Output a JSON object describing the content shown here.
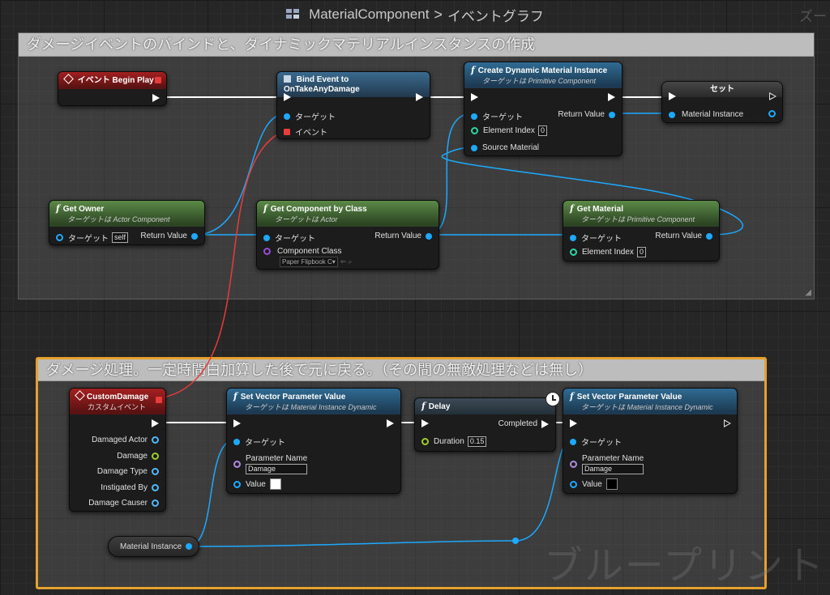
{
  "header": {
    "title": "MaterialComponent",
    "breadcrumb_sep": ">",
    "graph": "イベントグラフ",
    "zoom": "ズー"
  },
  "watermark": "ブループリント",
  "comments": [
    {
      "title": "ダメージイベントのバインドと、ダイナミックマテリアルインスタンスの作成"
    },
    {
      "title": "ダメージ処理。一定時間白加算した後で元に戻る。（その間の無敵処理などは無し）"
    }
  ],
  "nodes": {
    "begin_play": {
      "title": "イベント Begin Play"
    },
    "bind_event": {
      "title": "Bind Event to OnTakeAnyDamage",
      "target": "ターゲット",
      "event": "イベント"
    },
    "create_dmi": {
      "title": "Create Dynamic Material Instance",
      "subtitle": "ターゲットは Primitive Component",
      "target": "ターゲット",
      "return": "Return Value",
      "element_index": "Element Index",
      "element_index_val": "0",
      "source_material": "Source Material"
    },
    "set_node": {
      "title": "セット",
      "material_instance": "Material Instance"
    },
    "get_owner": {
      "title": "Get Owner",
      "subtitle": "ターゲットは Actor Component",
      "target": "ターゲット",
      "target_val": "self",
      "return": "Return Value"
    },
    "get_component": {
      "title": "Get Component by Class",
      "subtitle": "ターゲットは Actor",
      "target": "ターゲット",
      "return": "Return Value",
      "component_class": "Component Class",
      "component_class_val": "Paper Flipbook C▾"
    },
    "get_material": {
      "title": "Get Material",
      "subtitle": "ターゲットは Primitive Component",
      "target": "ターゲット",
      "return": "Return Value",
      "element_index": "Element Index",
      "element_index_val": "0"
    },
    "custom_damage": {
      "title": "CustomDamage",
      "subtitle": "カスタムイベント",
      "pins": [
        "Damaged Actor",
        "Damage",
        "Damage Type",
        "Instigated By",
        "Damage Causer"
      ]
    },
    "set_vec1": {
      "title": "Set Vector Parameter Value",
      "subtitle": "ターゲットは Material Instance Dynamic",
      "target": "ターゲット",
      "param_name": "Parameter Name",
      "param_val": "Damage",
      "value": "Value"
    },
    "delay": {
      "title": "Delay",
      "completed": "Completed",
      "duration": "Duration",
      "duration_val": "0.15"
    },
    "set_vec2": {
      "title": "Set Vector Parameter Value",
      "subtitle": "ターゲットは Material Instance Dynamic",
      "target": "ターゲット",
      "param_name": "Parameter Name",
      "param_val": "Damage",
      "value": "Value"
    },
    "mat_instance_var": {
      "title": "Material Instance"
    }
  },
  "colors": {
    "exec": "#ffffff",
    "object": "#1ca9ff",
    "event": "#e63c3c",
    "comment_border_selected": "#e6a12c"
  }
}
